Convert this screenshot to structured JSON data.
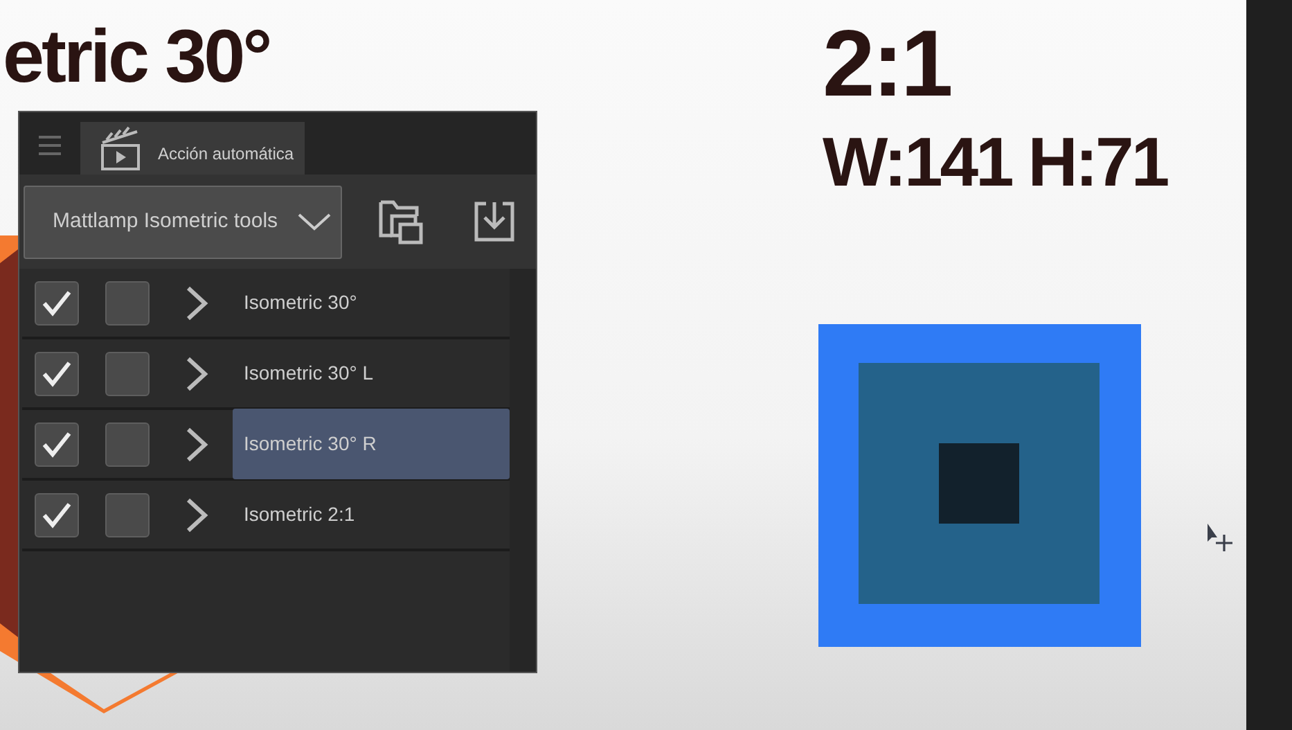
{
  "canvas": {
    "title": "etric 30°",
    "ratio": "2:1",
    "dimensions": "W:141 H:71"
  },
  "panel": {
    "tab": {
      "label": "Acción automática",
      "selected": true
    },
    "set_dropdown": {
      "value": "Mattlamp Isometric tools"
    },
    "actions": [
      {
        "label": "Isometric 30°",
        "checked": true,
        "dialog": false,
        "expanded": false,
        "selected": false
      },
      {
        "label": "Isometric 30° L",
        "checked": true,
        "dialog": false,
        "expanded": false,
        "selected": false
      },
      {
        "label": "Isometric 30° R",
        "checked": true,
        "dialog": false,
        "expanded": false,
        "selected": true
      },
      {
        "label": "Isometric 2:1",
        "checked": true,
        "dialog": false,
        "expanded": false,
        "selected": false
      }
    ]
  }
}
